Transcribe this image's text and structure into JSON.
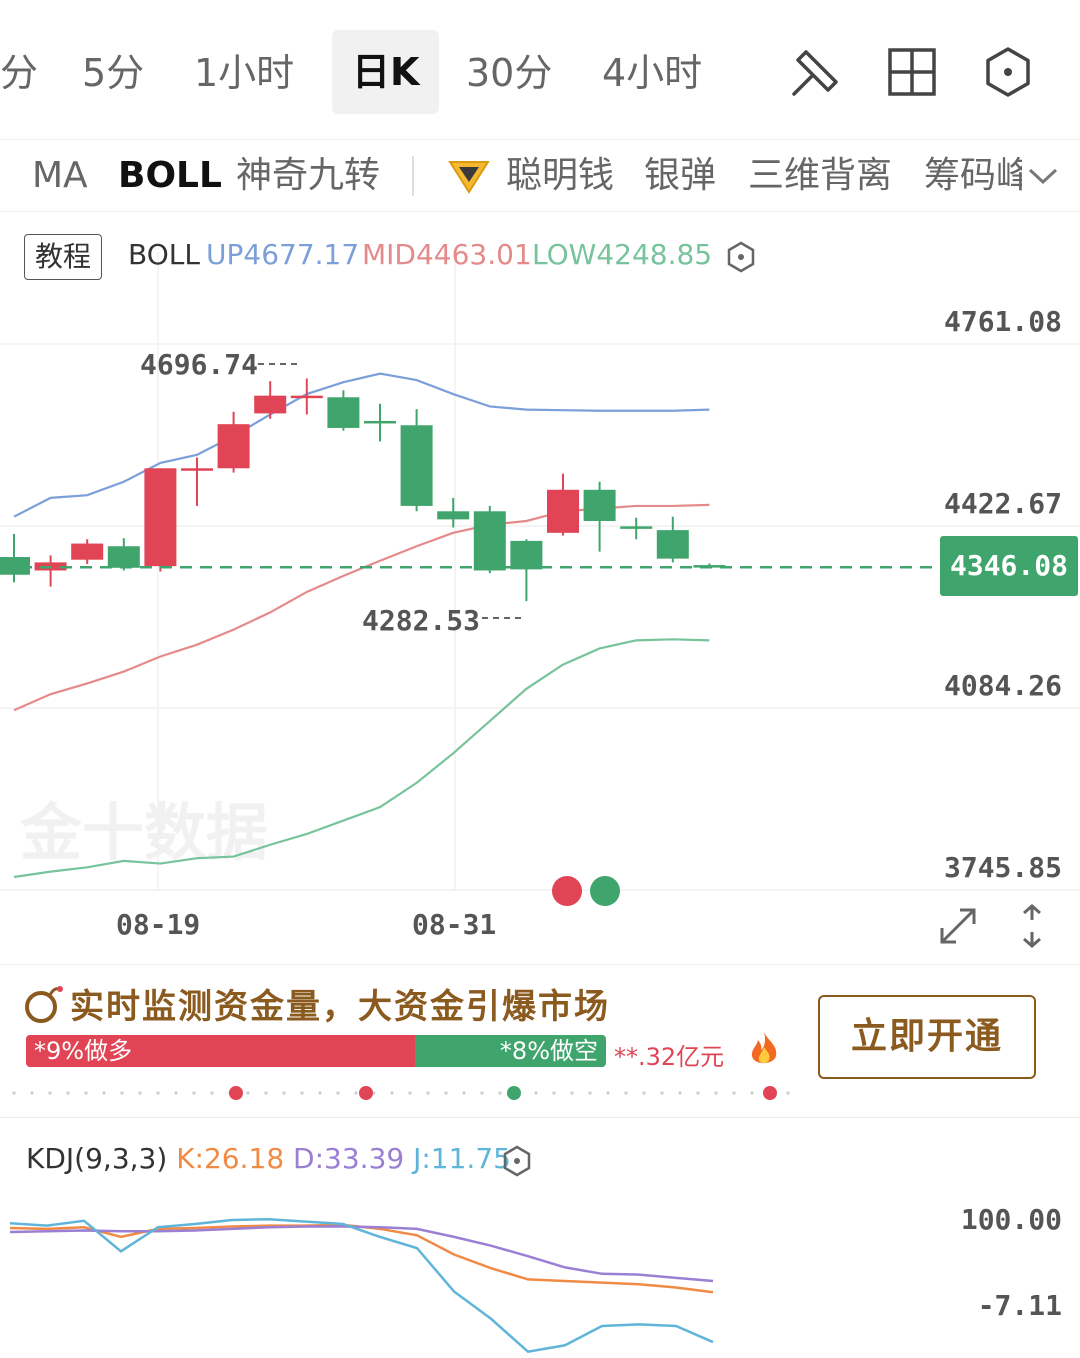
{
  "timeframes": {
    "partial": "分",
    "m5": "5分",
    "h1": "1小时",
    "daily": "日K",
    "m30": "30分",
    "h4": "4小时"
  },
  "toolbar_icons": [
    "draw-tool-icon",
    "layout-grid-icon",
    "settings-hexagon-icon"
  ],
  "indicators": {
    "ma": "MA",
    "boll": "BOLL",
    "td9": "神奇九转",
    "smart_money": "聪明钱",
    "silver_bullet": "银弹",
    "divergence": "三维背离",
    "chips": "筹码峰"
  },
  "boll_header": {
    "tutorial": "教程",
    "title": "BOLL",
    "up": "UP4677.17",
    "mid": "MID4463.01",
    "low": "LOW4248.85"
  },
  "colors": {
    "up": "#e04455",
    "down": "#3fa56c",
    "boll_up": "#7b9fd8",
    "boll_mid": "#e58a8a",
    "boll_low": "#77c39b",
    "k": "#f08b45",
    "d": "#9b7fd4",
    "j": "#5fb5d9",
    "brand": "#8a5a1e"
  },
  "y_axis": {
    "t1": "4761.08",
    "t2": "4422.67",
    "t3": "4084.26",
    "t4": "3745.85"
  },
  "current_price": "4346.08",
  "extremes": {
    "high": "4696.74",
    "low": "4282.53"
  },
  "x_axis": {
    "d1": "08-19",
    "d2": "08-31"
  },
  "watermark": "金十数据",
  "chart_data": {
    "type": "candlestick",
    "ylim": [
      3745.85,
      4761.08
    ],
    "candles": [
      {
        "o": 4365,
        "c": 4332,
        "h": 4408,
        "l": 4318
      },
      {
        "o": 4340,
        "c": 4355,
        "h": 4368,
        "l": 4310
      },
      {
        "o": 4360,
        "c": 4390,
        "h": 4398,
        "l": 4352
      },
      {
        "o": 4385,
        "c": 4345,
        "h": 4400,
        "l": 4340
      },
      {
        "o": 4348,
        "c": 4530,
        "h": 4530,
        "l": 4338
      },
      {
        "o": 4530,
        "c": 4530,
        "h": 4550,
        "l": 4460
      },
      {
        "o": 4530,
        "c": 4612,
        "h": 4635,
        "l": 4522
      },
      {
        "o": 4632,
        "c": 4665,
        "h": 4692,
        "l": 4622
      },
      {
        "o": 4665,
        "c": 4665,
        "h": 4697,
        "l": 4630
      },
      {
        "o": 4662,
        "c": 4605,
        "h": 4675,
        "l": 4600
      },
      {
        "o": 4618,
        "c": 4615,
        "h": 4650,
        "l": 4580
      },
      {
        "o": 4610,
        "c": 4460,
        "h": 4640,
        "l": 4450
      },
      {
        "o": 4450,
        "c": 4435,
        "h": 4475,
        "l": 4420
      },
      {
        "o": 4450,
        "c": 4340,
        "h": 4460,
        "l": 4335
      },
      {
        "o": 4395,
        "c": 4342,
        "h": 4398,
        "l": 4283
      },
      {
        "o": 4410,
        "c": 4490,
        "h": 4520,
        "l": 4405
      },
      {
        "o": 4490,
        "c": 4432,
        "h": 4505,
        "l": 4375
      },
      {
        "o": 4422,
        "c": 4418,
        "h": 4438,
        "l": 4398
      },
      {
        "o": 4415,
        "c": 4362,
        "h": 4440,
        "l": 4355
      },
      {
        "o": 4350,
        "c": 4346,
        "h": 4353,
        "l": 4344
      }
    ],
    "boll_up": [
      4440,
      4475,
      4480,
      4505,
      4540,
      4555,
      4590,
      4630,
      4668,
      4690,
      4706,
      4694,
      4668,
      4645,
      4639,
      4638,
      4637,
      4637,
      4637,
      4639
    ],
    "boll_mid": [
      4080,
      4110,
      4130,
      4152,
      4180,
      4202,
      4230,
      4262,
      4300,
      4330,
      4358,
      4385,
      4410,
      4425,
      4432,
      4450,
      4455,
      4460,
      4460,
      4462
    ],
    "boll_low": [
      3770,
      3780,
      3788,
      3800,
      3795,
      3805,
      3808,
      3830,
      3850,
      3875,
      3900,
      3945,
      4000,
      4060,
      4120,
      4165,
      4195,
      4210,
      4212,
      4210
    ],
    "kdj": {
      "k": [
        85,
        84,
        86,
        74,
        84,
        85,
        87,
        88,
        88,
        89,
        84,
        76,
        52,
        35,
        21,
        19,
        17,
        15,
        11,
        5
      ],
      "d": [
        80,
        81,
        82,
        81,
        81,
        82,
        84,
        86,
        87,
        87,
        86,
        84,
        74,
        63,
        50,
        36,
        28,
        27,
        23,
        19
      ],
      "j": [
        91,
        88,
        94,
        56,
        86,
        90,
        95,
        96,
        93,
        90,
        74,
        60,
        6,
        -28,
        -69,
        -61,
        -37,
        -35,
        -37,
        -57
      ],
      "ylim": [
        -7.11,
        100.0
      ]
    }
  },
  "promo": {
    "title": "实时监测资金量，大资金引爆市场",
    "long_label": "*9%做多",
    "short_label": "*8%做空",
    "long_ratio": 0.67,
    "amount": "**.32亿元",
    "cta": "立即开通"
  },
  "kdj_header": {
    "title": "KDJ(9,3,3)",
    "k": "K:26.18",
    "d": "D:33.39",
    "j": "J:11.75"
  },
  "kdj_axis": {
    "top": "100.00",
    "bottom": "-7.11"
  }
}
